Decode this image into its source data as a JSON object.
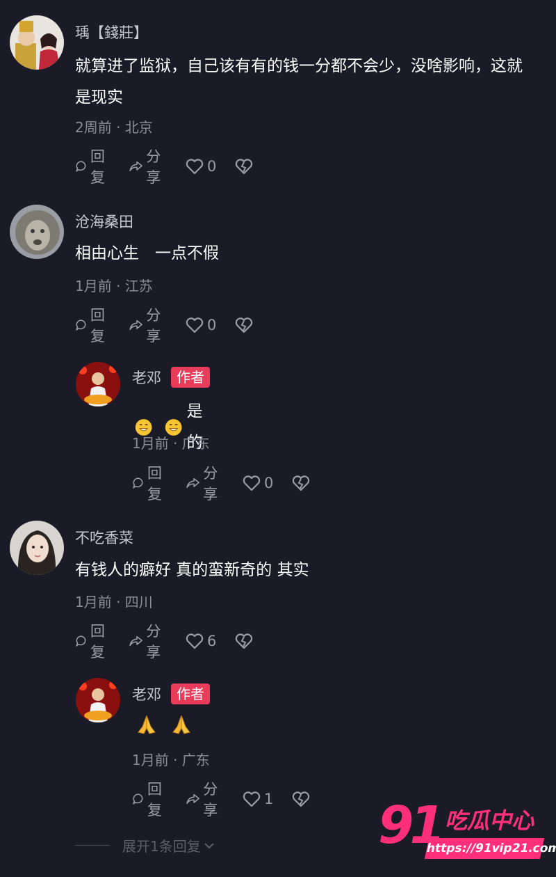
{
  "comments": [
    {
      "name": "瑀【錢莊】",
      "text": "就算进了监狱，自己该有有的钱一分都不会少，没啥影响，这就是现实",
      "meta": "2周前 · 北京",
      "reply_label": "回复",
      "share_label": "分享",
      "likes": "0"
    },
    {
      "name": "沧海桑田",
      "text": "相由心生　一点不假",
      "meta": "1月前 · 江苏",
      "reply_label": "回复",
      "share_label": "分享",
      "likes": "0"
    },
    {
      "name": "老邓",
      "badge": "作者",
      "text": "是的",
      "emojis": [
        "grin-icon",
        "grin-icon"
      ],
      "meta": "1月前 · 广东",
      "reply_label": "回复",
      "share_label": "分享",
      "likes": "0"
    },
    {
      "name": "不吃香菜",
      "text": "有钱人的癖好 真的蛮新奇的 其实",
      "meta": "1月前 · 四川",
      "reply_label": "回复",
      "share_label": "分享",
      "likes": "6"
    },
    {
      "name": "老邓",
      "badge": "作者",
      "text": "",
      "emojis": [
        "pray-icon",
        "pray-icon"
      ],
      "meta": "1月前 · 广东",
      "reply_label": "回复",
      "share_label": "分享",
      "likes": "1"
    }
  ],
  "expand_label": "展开1条回复",
  "watermark": {
    "number": "91",
    "title": "吃瓜中心",
    "url": "https://91vip21.com"
  },
  "colors": {
    "background": "#1a1b26",
    "badge": "#e93c5a",
    "watermark": "#ff2f7a"
  }
}
